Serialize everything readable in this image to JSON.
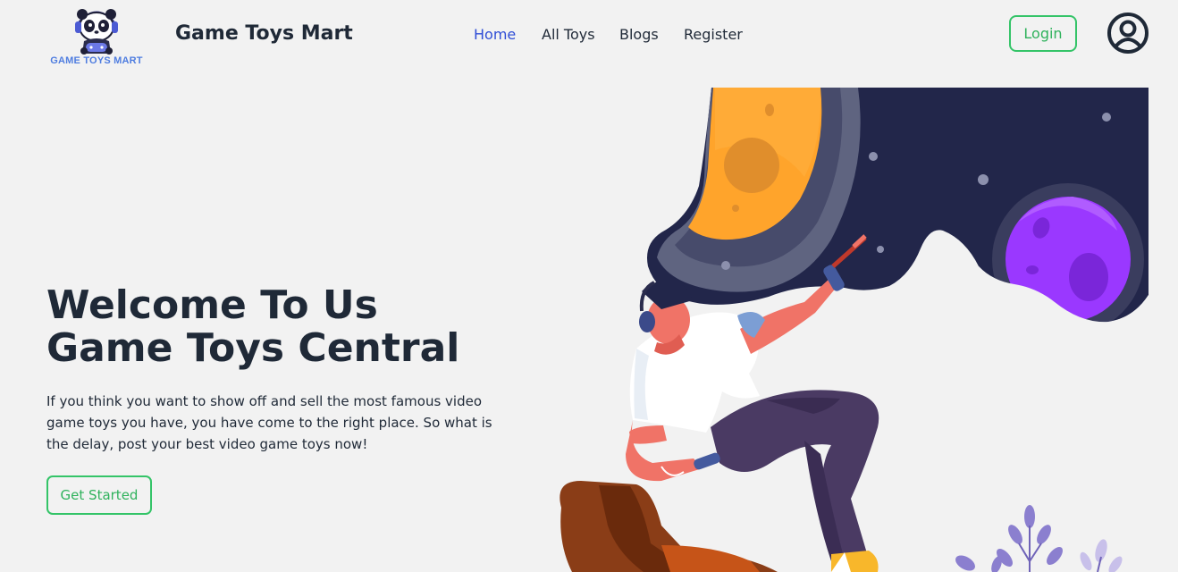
{
  "brand": {
    "logo_text": "GAME TOYS MART",
    "name": "Game Toys Mart"
  },
  "nav": {
    "links": [
      {
        "label": "Home",
        "active": true
      },
      {
        "label": "All Toys",
        "active": false
      },
      {
        "label": "Blogs",
        "active": false
      },
      {
        "label": "Register",
        "active": false
      }
    ],
    "login_label": "Login"
  },
  "hero": {
    "title_line1": "Welcome To Us",
    "title_line2": "Game Toys Central",
    "description": "If you think you want to show off and sell the most famous video game toys you have, you have come to the right place. So what is the delay, post your best video game toys now!",
    "cta_label": "Get Started"
  },
  "colors": {
    "accent_green": "#34c468",
    "active_nav": "#2f4dd6",
    "text_dark": "#1f2937",
    "background": "#f2f2f2",
    "space_navy": "#22264a",
    "planet_orange": "#ffa42b",
    "planet_purple": "#9a38ff"
  },
  "icons": {
    "logo": "panda-gamer-logo",
    "avatar": "user-circle-icon"
  }
}
